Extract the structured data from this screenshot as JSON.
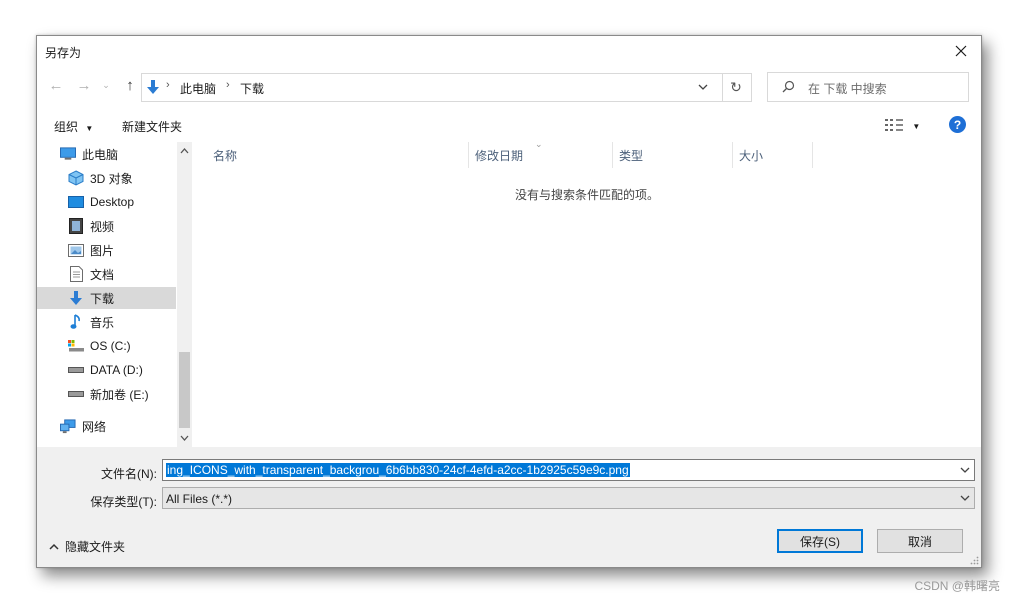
{
  "window": {
    "title": "另存为"
  },
  "nav": {
    "breadcrumb": [
      "此电脑",
      "下载"
    ],
    "search_placeholder": "在 下载 中搜索"
  },
  "toolbar": {
    "organize_label": "组织",
    "new_folder_label": "新建文件夹"
  },
  "tree": {
    "items": [
      {
        "label": "此电脑",
        "icon": "computer-icon"
      },
      {
        "label": "3D 对象",
        "icon": "cube-icon"
      },
      {
        "label": "Desktop",
        "icon": "desktop-icon"
      },
      {
        "label": "视频",
        "icon": "video-icon"
      },
      {
        "label": "图片",
        "icon": "picture-icon"
      },
      {
        "label": "文档",
        "icon": "document-icon"
      },
      {
        "label": "下载",
        "icon": "download-icon",
        "selected": true
      },
      {
        "label": "音乐",
        "icon": "music-icon"
      },
      {
        "label": "OS (C:)",
        "icon": "drive-icon"
      },
      {
        "label": "DATA (D:)",
        "icon": "drive-icon"
      },
      {
        "label": "新加卷 (E:)",
        "icon": "drive-icon"
      },
      {
        "label": "网络",
        "icon": "network-icon"
      }
    ]
  },
  "filelist": {
    "columns": [
      "名称",
      "修改日期",
      "类型",
      "大小"
    ],
    "empty_message": "没有与搜索条件匹配的项。"
  },
  "form": {
    "filename_label": "文件名(N):",
    "filename_value": "ing_ICONS_with_transparent_backgrou_6b6bb830-24cf-4efd-a2cc-1b2925c59e9c.png",
    "filetype_label": "保存类型(T):",
    "filetype_value": "All Files (*.*)"
  },
  "footer": {
    "hide_folders_label": "隐藏文件夹",
    "save_label": "保存(S)",
    "cancel_label": "取消"
  },
  "watermark": "CSDN @韩曙亮",
  "colors": {
    "accent": "#0078d7",
    "selection": "#d9d9d9",
    "download_blue": "#2b7cd3"
  }
}
